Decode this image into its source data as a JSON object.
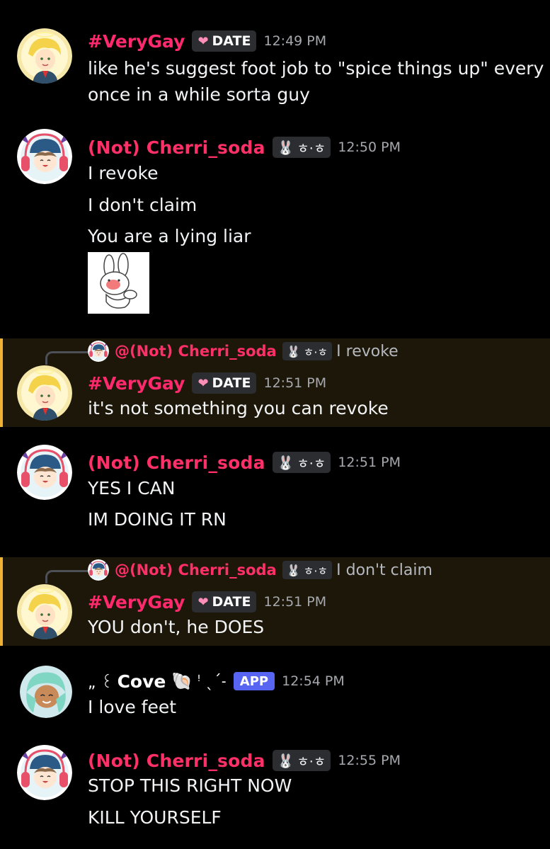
{
  "colors": {
    "background": "#000000",
    "reply_highlight": "#1c1708",
    "reply_accent": "#f0b232",
    "name_pink": "#ff2f68",
    "app_badge": "#5865f2"
  },
  "users": {
    "verygay": {
      "name": "#VeryGay",
      "tag": "DATE",
      "tag_icon": "heart-icon"
    },
    "cherri": {
      "name": "(Not) Cherri_soda",
      "tag": "ㅎ·ㅎ",
      "tag_icon": "bunny-icon"
    },
    "cove": {
      "prefix": "„ ꒰",
      "name": "Cove",
      "suffix": "ꜝ ˎˊ˗",
      "icon": "shell-icon",
      "badge": "APP"
    }
  },
  "messages": [
    {
      "author": "#VeryGay",
      "time": "12:49 PM",
      "lines": [
        "like he's suggest foot job to \"spice things up\" every",
        "once in a while sorta guy"
      ]
    },
    {
      "author": "(Not) Cherri_soda",
      "time": "12:50 PM",
      "lines": [
        "I revoke",
        "I don't claim",
        "You are a lying liar"
      ],
      "sticker": "crying-bunny-sticker"
    },
    {
      "author": "#VeryGay",
      "time": "12:51 PM",
      "reply": {
        "to": "@(Not) Cherri_soda",
        "text": "I revoke"
      },
      "lines": [
        "it's not something you can revoke"
      ]
    },
    {
      "author": "(Not) Cherri_soda",
      "time": "12:51 PM",
      "lines": [
        "YES I CAN",
        "IM DOING IT RN"
      ]
    },
    {
      "author": "#VeryGay",
      "time": "12:51 PM",
      "reply": {
        "to": "@(Not) Cherri_soda",
        "text": "I don't claim"
      },
      "lines": [
        "YOU don't, he DOES"
      ]
    },
    {
      "author": "Cove",
      "time": "12:54 PM",
      "lines": [
        "I love feet"
      ]
    },
    {
      "author": "(Not) Cherri_soda",
      "time": "12:55 PM",
      "lines": [
        "STOP THIS RIGHT NOW",
        "KILL YOURSELF"
      ]
    }
  ]
}
